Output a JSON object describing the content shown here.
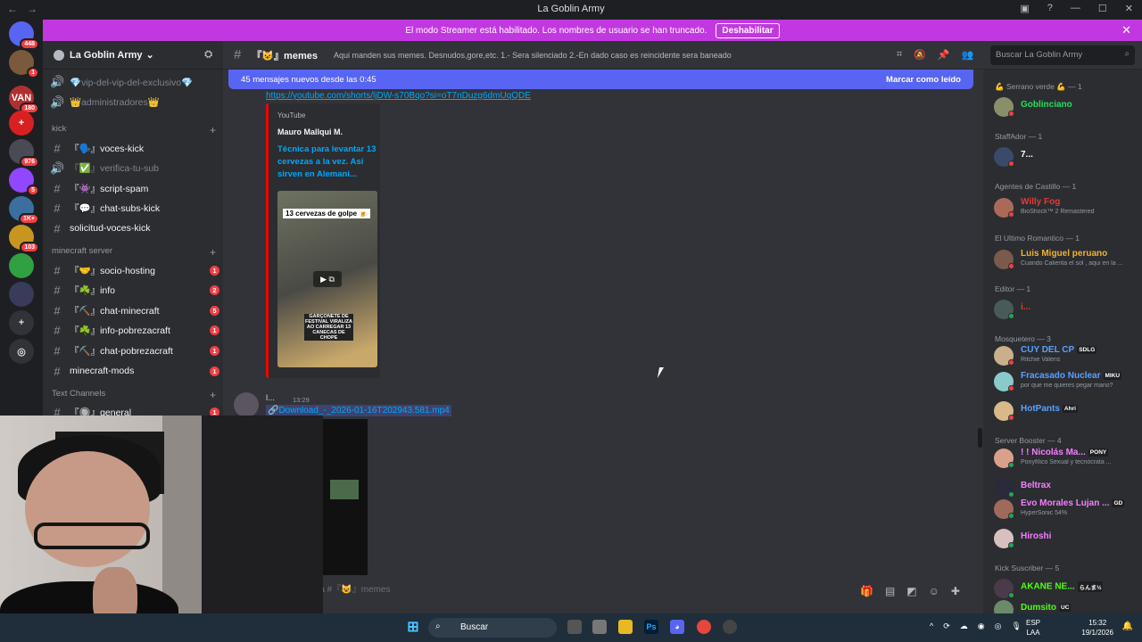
{
  "window": {
    "title": "La Goblin Army"
  },
  "banner": {
    "text": "El modo Streamer está habilitado. Los nombres de usuario se han truncado.",
    "button": "Deshabilitar"
  },
  "servers": [
    {
      "label": "",
      "badge": "448",
      "color": "#5865f2"
    },
    {
      "label": "",
      "badge": "1",
      "color": "#7a5a3a"
    },
    {
      "label": "VAN",
      "badge": "180",
      "color": "#b03030"
    },
    {
      "label": "+",
      "badge": "",
      "color": "#d92020"
    },
    {
      "label": "",
      "badge": "976",
      "color": "#4a4a55"
    },
    {
      "label": "",
      "badge": "5",
      "color": "#9146ff"
    },
    {
      "label": "",
      "badge": "1K+",
      "color": "#3a6fa0"
    },
    {
      "label": "",
      "badge": "103",
      "color": "#c8961e"
    },
    {
      "label": "",
      "badge": "",
      "color": "#30a040"
    },
    {
      "label": "",
      "badge": "",
      "color": "#3a3a5a"
    }
  ],
  "guild": {
    "name": "La Goblin Army"
  },
  "channels": {
    "top": [
      {
        "name": "💎vip-del-vip-del-exclusivo💎",
        "muted": true
      },
      {
        "name": "👑administradores👑",
        "muted": true
      }
    ],
    "cat_kick": "kick",
    "kick": [
      {
        "name": "『🗣️』voces-kick",
        "badge": ""
      },
      {
        "name": "『✅』verifica-tu-sub",
        "badge": "",
        "muted": true
      },
      {
        "name": "『👾』script-spam",
        "badge": ""
      },
      {
        "name": "『💬』chat-subs-kick",
        "badge": ""
      },
      {
        "name": "solicitud-voces-kick",
        "badge": ""
      }
    ],
    "cat_mc": "minecraft server",
    "mc": [
      {
        "name": "『🤝』socio-hosting",
        "badge": "1"
      },
      {
        "name": "『☘️』info",
        "badge": "2"
      },
      {
        "name": "『⛏️』chat-minecraft",
        "badge": "5"
      },
      {
        "name": "『☘️』info-pobrezacraft",
        "badge": "1"
      },
      {
        "name": "『⛏️』chat-pobrezacraft",
        "badge": "1"
      },
      {
        "name": "minecraft-mods",
        "badge": "1"
      }
    ],
    "cat_text": "Text Channels",
    "text": [
      {
        "name": "『🔘』general",
        "badge": "1"
      }
    ]
  },
  "header": {
    "channel": "『😺』memes",
    "topic": "Aqui manden sus memes. Desnudos,gore,etc. 1.- Sera silenciado 2.-En dado caso es reincidente sera baneado",
    "search_placeholder": "Buscar La Goblin Army"
  },
  "chat": {
    "new_messages": "45 mensajes nuevos desde las 0:45",
    "mark_read": "Marcar como leído",
    "link": "https://youtube.com/shorts/ljDW-s70Bqo?si=oT7nDuzg6dmUqQDE",
    "embed": {
      "provider": "YouTube",
      "author": "Mauro Mallqui M.",
      "title": "Técnica para levantar 13 cervezas a la vez. Así sirven en Alemani...",
      "thumb_caption": "13 cervezas de golpe 🍺",
      "thumb_caption2": "GARÇONETE DE FESTIVAL VIRALIZA AO CARREGAR 13 CANECAS DE CHOPE"
    },
    "msg2": {
      "name": "l...",
      "time": "13:29",
      "attachment": "Download_-_2026-01-16T202943.581.mp4"
    },
    "composer": "e a #『😺』memes"
  },
  "members": [
    {
      "category": "💪 Serrano verde 💪 — 1",
      "items": [
        {
          "name": "Goblinciano",
          "color": "#23e05a",
          "activity": "",
          "tag": ""
        }
      ]
    },
    {
      "category": "StaffAdor — 1",
      "items": [
        {
          "name": "7...",
          "color": "#ffffff",
          "activity": "",
          "tag": ""
        }
      ]
    },
    {
      "category": "Agentes de Castillo — 1",
      "items": [
        {
          "name": "Willy Fog",
          "color": "#e53935",
          "activity": "BioShock™ 2 Remastered",
          "tag": ""
        }
      ]
    },
    {
      "category": "El Ultimo Romantico — 1",
      "items": [
        {
          "name": "Luis Miguel peruano",
          "color": "#f0b232",
          "activity": "Cuando Calienta el sol , aqui en la ...",
          "tag": ""
        }
      ]
    },
    {
      "category": "Editor — 1",
      "items": [
        {
          "name": "i...",
          "color": "#e53935",
          "activity": "",
          "tag": ""
        }
      ]
    },
    {
      "category": "Mosquetero — 3",
      "items": [
        {
          "name": "CUY DEL CP",
          "color": "#5aa0ff",
          "activity": "Ritchie Valens",
          "tag": "SDLG"
        },
        {
          "name": "Fracasado Nuclear",
          "color": "#5aa0ff",
          "activity": "por que me quieres pegar mano?",
          "tag": "MIKU"
        },
        {
          "name": "HotPants",
          "color": "#5aa0ff",
          "activity": "",
          "tag": "Ahri"
        }
      ]
    },
    {
      "category": "Server Booster — 4",
      "items": [
        {
          "name": "! ! Nicolás Ma...",
          "color": "#f47fff",
          "activity": "Ponyfílico Sexual y tecnócrata ...",
          "tag": "PONY"
        },
        {
          "name": "Beltrax",
          "color": "#f47fff",
          "activity": "",
          "tag": ""
        },
        {
          "name": "Evo Morales Lujan ...",
          "color": "#f47fff",
          "activity": "HyperSonic 54%",
          "tag": "GD"
        },
        {
          "name": "Hiroshi",
          "color": "#f47fff",
          "activity": "",
          "tag": ""
        }
      ]
    },
    {
      "category": "Kick Suscriber — 5",
      "items": [
        {
          "name": "AKANE NE...",
          "color": "#53fc18",
          "activity": "",
          "tag": "らんま½"
        },
        {
          "name": "Dumsito",
          "color": "#53fc18",
          "activity": "",
          "tag": "UC"
        }
      ]
    }
  ],
  "taskbar": {
    "search": "Buscar",
    "lang1": "ESP",
    "lang2": "LAA",
    "time": "15:32",
    "date": "19/1/2026"
  }
}
